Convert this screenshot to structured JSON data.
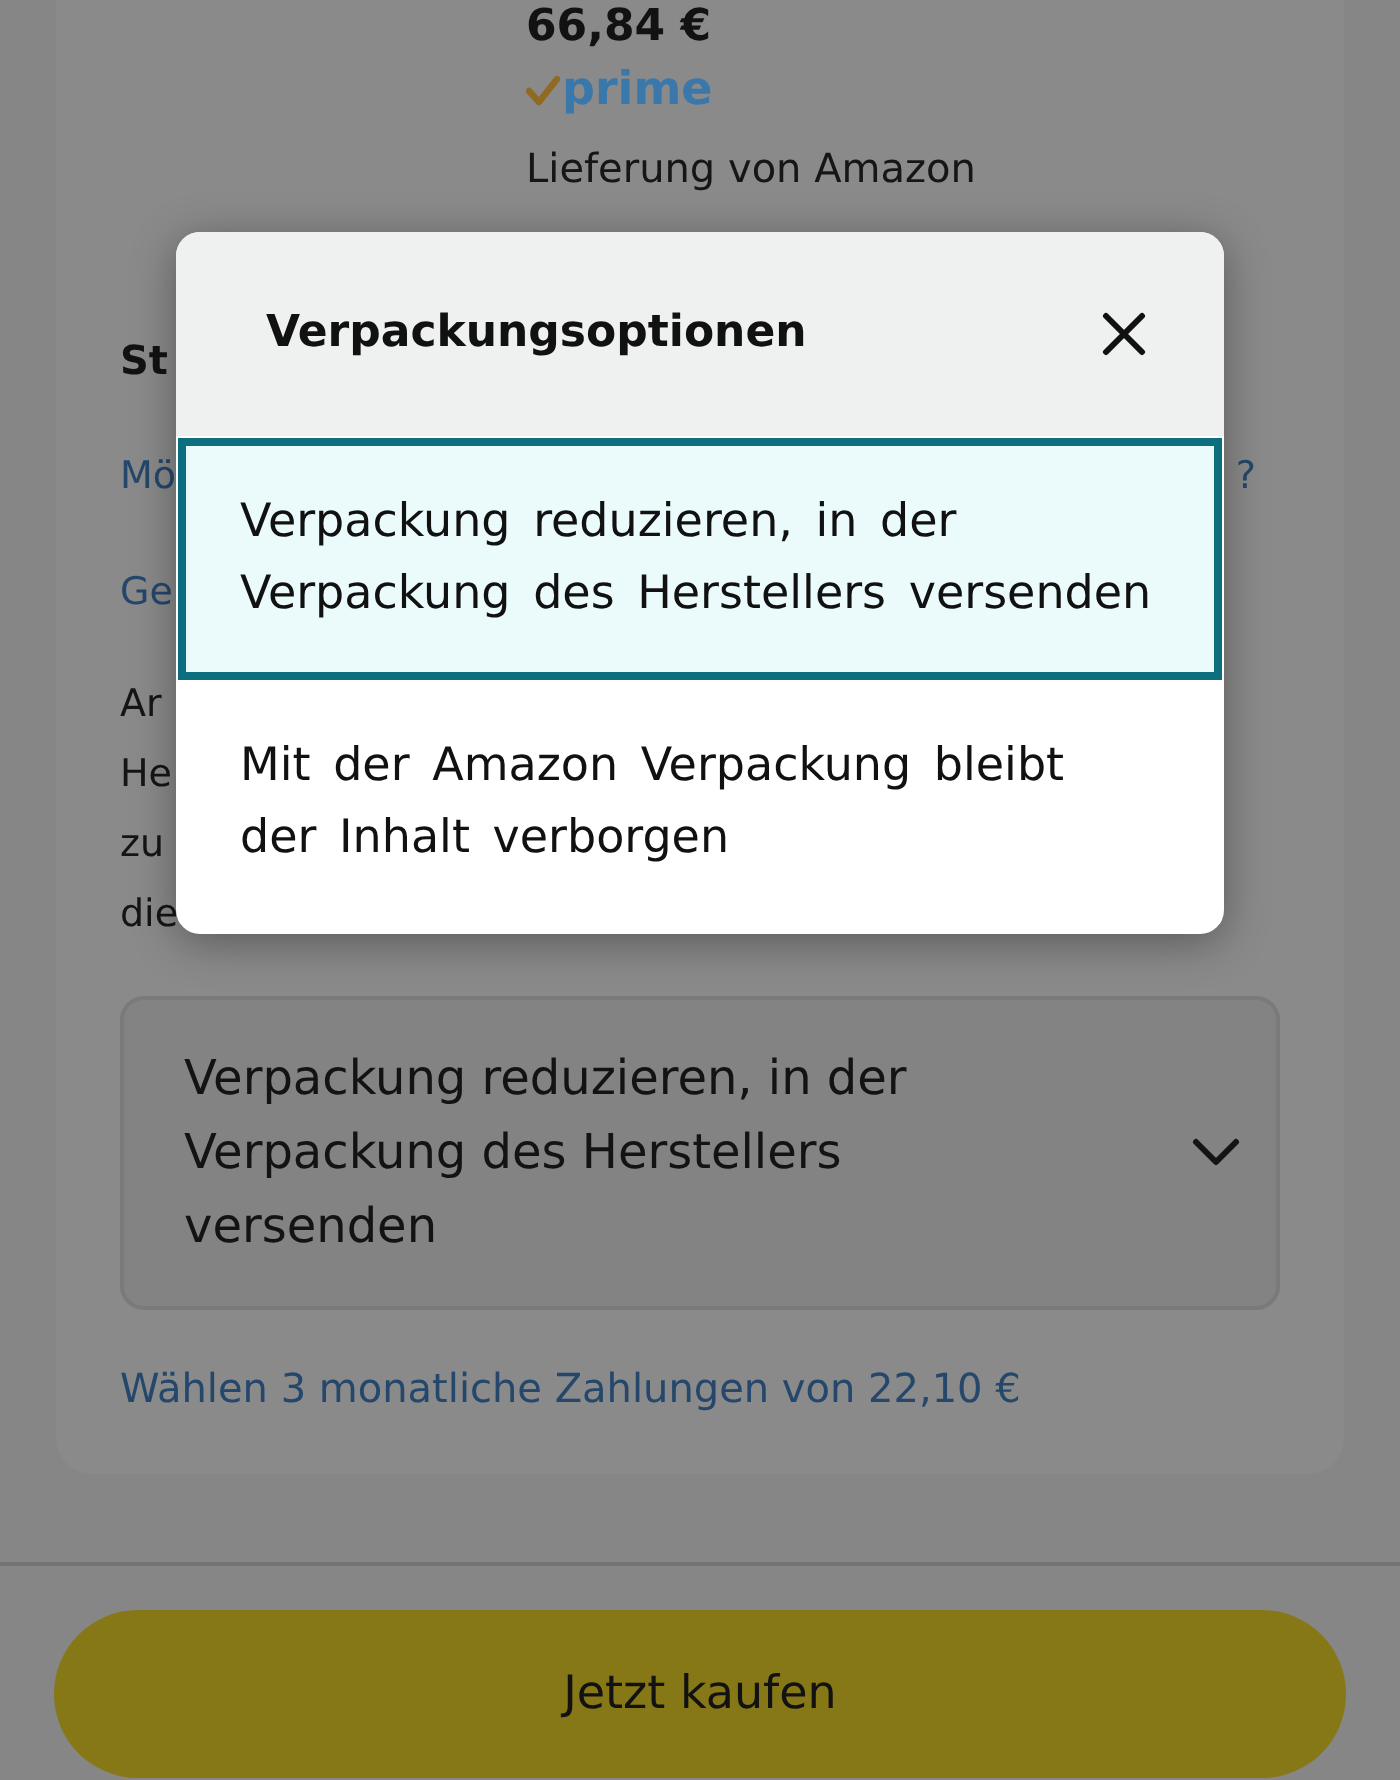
{
  "product": {
    "price": "66,84 €",
    "badge": "prime",
    "delivery": "Lieferung von Amazon"
  },
  "background_fragments": [
    {
      "kind": "heading",
      "text": "St"
    },
    {
      "kind": "link",
      "text": "Mö",
      "end": "?"
    },
    {
      "kind": "link",
      "text": "Ge"
    },
    {
      "kind": "text",
      "text": "Ar"
    },
    {
      "kind": "text",
      "text": "He"
    },
    {
      "kind": "text",
      "text": "zu"
    },
    {
      "kind": "text",
      "text": "die"
    }
  ],
  "packaging_select": {
    "value": "Verpackung reduzieren, in der Verpackung des Herstellers versenden"
  },
  "installment_link": "Wählen 3 monatliche Zahlungen von 22,10 €",
  "buy_button": {
    "label": "Jetzt kaufen"
  },
  "modal": {
    "title": "Verpackungsoptionen",
    "options": [
      {
        "label": "Verpackung reduzieren, in der Verpackung des Herstellers versenden",
        "selected": true
      },
      {
        "label": "Mit der Amazon Verpackung bleibt der Inhalt verborgen",
        "selected": false
      }
    ]
  }
}
